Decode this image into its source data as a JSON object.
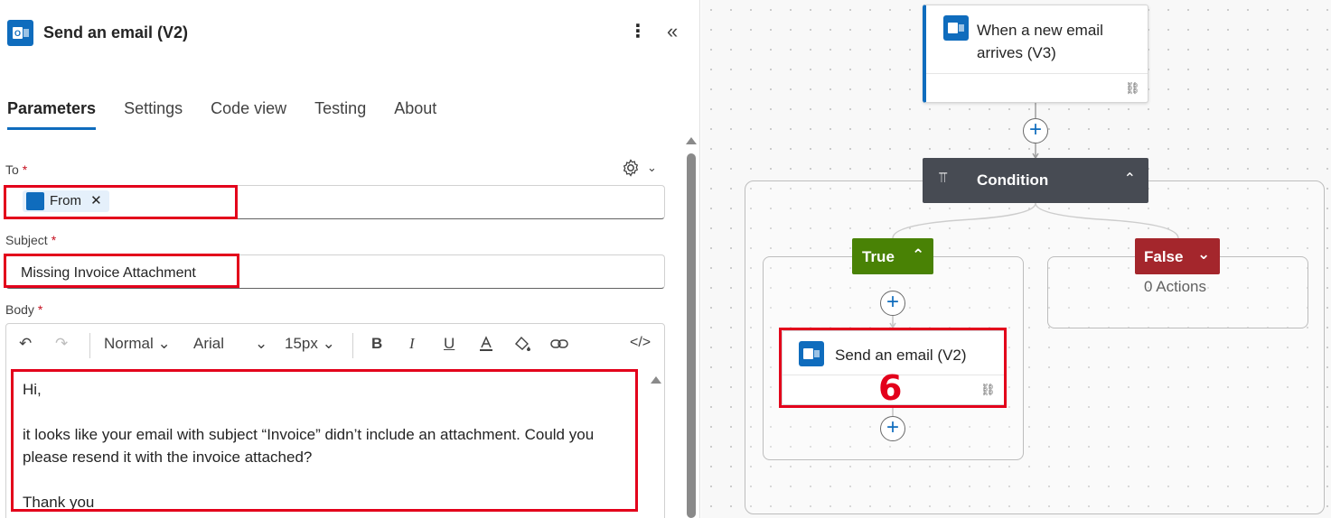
{
  "panel": {
    "title": "Send an email (V2)",
    "more_label": "⋮",
    "collapse_label": "«",
    "tabs": [
      {
        "label": "Parameters"
      },
      {
        "label": "Settings"
      },
      {
        "label": "Code view"
      },
      {
        "label": "Testing"
      },
      {
        "label": "About"
      }
    ],
    "fields": {
      "to_label": "To",
      "required_mark": "*",
      "to_token": "From",
      "to_token_remove": "✕",
      "subject_label": "Subject",
      "subject_value": "Missing Invoice Attachment",
      "body_label": "Body"
    },
    "editor": {
      "undo": "↶",
      "redo": "↷",
      "format": "Normal",
      "font": "Arial",
      "size": "15px",
      "bold": "B",
      "italic": "I",
      "underline": "U",
      "code": "</>",
      "lines": [
        "Hi,",
        "",
        "it looks like your email with subject “Invoice” didn’t include an attachment. Could you please resend it with the invoice attached?",
        "",
        "Thank you"
      ]
    }
  },
  "canvas": {
    "trigger": {
      "title": "When a new email arrives (V3)"
    },
    "condition": {
      "title": "Condition"
    },
    "true_branch": {
      "label": "True"
    },
    "false_branch": {
      "label": "False",
      "empty_text": "0 Actions"
    },
    "action": {
      "title": "Send an email (V2)"
    },
    "step_number": "6"
  },
  "colors": {
    "accent": "#0f6cbd",
    "highlight": "#e3001b",
    "true": "#498205",
    "false": "#a4262c",
    "condition": "#474b53"
  }
}
